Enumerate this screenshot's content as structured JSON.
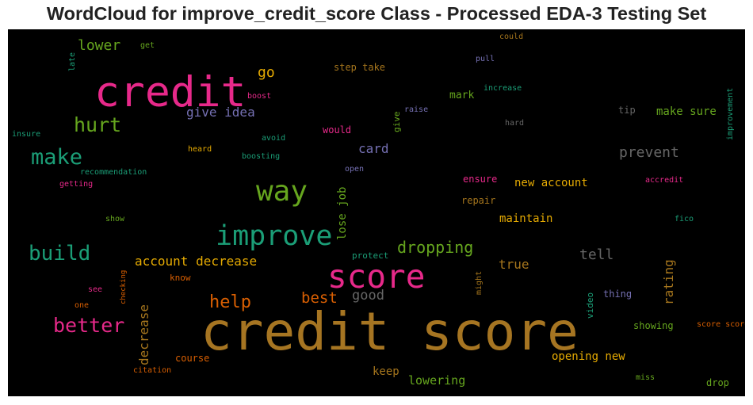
{
  "title": "WordCloud for improve_credit_score Class - Processed EDA-3 Testing Set",
  "words": [
    {
      "text": "credit score",
      "color": "#a67522"
    },
    {
      "text": "credit",
      "color": "#e7298a"
    },
    {
      "text": "score",
      "color": "#e7298a"
    },
    {
      "text": "improve",
      "color": "#1b9e77"
    },
    {
      "text": "way",
      "color": "#66a61e"
    },
    {
      "text": "make",
      "color": "#1b9e77"
    },
    {
      "text": "hurt",
      "color": "#66a61e"
    },
    {
      "text": "build",
      "color": "#1b9e77"
    },
    {
      "text": "better",
      "color": "#e7298a"
    },
    {
      "text": "help",
      "color": "#d95f02"
    },
    {
      "text": "best",
      "color": "#d95f02"
    },
    {
      "text": "lower",
      "color": "#66a61e"
    },
    {
      "text": "dropping",
      "color": "#66a61e"
    },
    {
      "text": "prevent",
      "color": "#666666"
    },
    {
      "text": "tell",
      "color": "#666666"
    },
    {
      "text": "account decrease",
      "color": "#e6ab02"
    },
    {
      "text": "decrease",
      "color": "#a6761d"
    },
    {
      "text": "give idea",
      "color": "#7570b3"
    },
    {
      "text": "go",
      "color": "#e6ab02"
    },
    {
      "text": "good",
      "color": "#666666"
    },
    {
      "text": "card",
      "color": "#7570b3"
    },
    {
      "text": "rating",
      "color": "#a6761d"
    },
    {
      "text": "true",
      "color": "#a6761d"
    },
    {
      "text": "lowering",
      "color": "#66a61e"
    },
    {
      "text": "keep",
      "color": "#a6761d"
    },
    {
      "text": "lose job",
      "color": "#66a61e"
    },
    {
      "text": "make sure",
      "color": "#66a61e"
    },
    {
      "text": "new account",
      "color": "#e6ab02"
    },
    {
      "text": "maintain",
      "color": "#e6ab02"
    },
    {
      "text": "opening new",
      "color": "#e6ab02"
    },
    {
      "text": "mark",
      "color": "#66a61e"
    },
    {
      "text": "step take",
      "color": "#a6761d"
    },
    {
      "text": "would",
      "color": "#e7298a"
    },
    {
      "text": "ensure",
      "color": "#e7298a"
    },
    {
      "text": "repair",
      "color": "#a6761d"
    },
    {
      "text": "course",
      "color": "#d95f02"
    },
    {
      "text": "know",
      "color": "#d95f02"
    },
    {
      "text": "protect",
      "color": "#1b9e77"
    },
    {
      "text": "showing",
      "color": "#66a61e"
    },
    {
      "text": "thing",
      "color": "#7570b3"
    },
    {
      "text": "tip",
      "color": "#666666"
    },
    {
      "text": "drop",
      "color": "#66a61e"
    },
    {
      "text": "give",
      "color": "#66a61e"
    },
    {
      "text": "video",
      "color": "#1b9e77"
    },
    {
      "text": "might",
      "color": "#a6761d"
    },
    {
      "text": "heard",
      "color": "#e6ab02"
    },
    {
      "text": "avoid",
      "color": "#1b9e77"
    },
    {
      "text": "boosting",
      "color": "#1b9e77"
    },
    {
      "text": "boost",
      "color": "#e7298a"
    },
    {
      "text": "raise",
      "color": "#7570b3"
    },
    {
      "text": "increase",
      "color": "#1b9e77"
    },
    {
      "text": "pull",
      "color": "#7570b3"
    },
    {
      "text": "could",
      "color": "#a6761d"
    },
    {
      "text": "hard",
      "color": "#666666"
    },
    {
      "text": "improvement",
      "color": "#1b9e77"
    },
    {
      "text": "accredit",
      "color": "#e7298a"
    },
    {
      "text": "fico",
      "color": "#1b9e77"
    },
    {
      "text": "score score",
      "color": "#d95f02"
    },
    {
      "text": "miss",
      "color": "#66a61e"
    },
    {
      "text": "get",
      "color": "#66a61e"
    },
    {
      "text": "late",
      "color": "#1b9e77"
    },
    {
      "text": "insure",
      "color": "#1b9e77"
    },
    {
      "text": "recommendation",
      "color": "#1b9e77"
    },
    {
      "text": "getting",
      "color": "#e7298a"
    },
    {
      "text": "show",
      "color": "#66a61e"
    },
    {
      "text": "see",
      "color": "#e7298a"
    },
    {
      "text": "one",
      "color": "#d95f02"
    },
    {
      "text": "checking",
      "color": "#d95f02"
    },
    {
      "text": "citation",
      "color": "#d95f02"
    },
    {
      "text": "open",
      "color": "#7570b3"
    }
  ]
}
